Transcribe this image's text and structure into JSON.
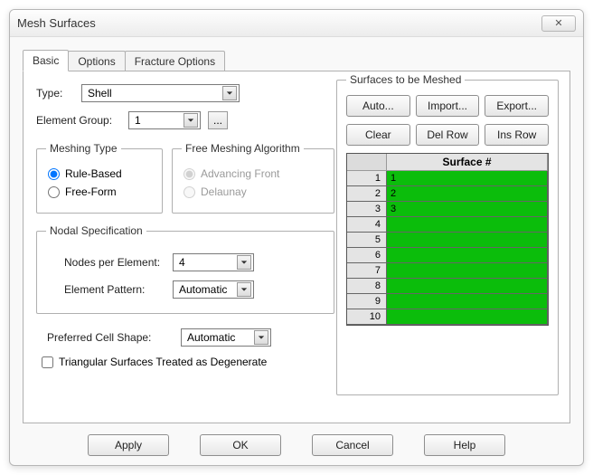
{
  "window": {
    "title": "Mesh Surfaces"
  },
  "tabs": {
    "basic": "Basic",
    "options": "Options",
    "fracture": "Fracture Options"
  },
  "labels": {
    "type": "Type:",
    "element_group": "Element Group:",
    "meshing_type": "Meshing Type",
    "rule_based": "Rule-Based",
    "free_form": "Free-Form",
    "free_meshing": "Free Meshing Algorithm",
    "advancing_front": "Advancing Front",
    "delaunay": "Delaunay",
    "nodal_spec": "Nodal Specification",
    "nodes_per_elem": "Nodes per Element:",
    "element_pattern": "Element Pattern:",
    "pref_cell_shape": "Preferred Cell Shape:",
    "triangular": "Triangular Surfaces Treated as Degenerate",
    "surfaces_group": "Surfaces to be Meshed",
    "surface_col": "Surface #",
    "ellipsis": "..."
  },
  "values": {
    "type": "Shell",
    "element_group": "1",
    "nodes_per_elem": "4",
    "element_pattern": "Automatic",
    "pref_cell_shape": "Automatic"
  },
  "right_buttons": {
    "auto": "Auto...",
    "import": "Import...",
    "export": "Export...",
    "clear": "Clear",
    "delrow": "Del Row",
    "insrow": "Ins Row"
  },
  "grid": {
    "rows": [
      {
        "idx": "1",
        "val": "1"
      },
      {
        "idx": "2",
        "val": "2"
      },
      {
        "idx": "3",
        "val": "3"
      },
      {
        "idx": "4",
        "val": ""
      },
      {
        "idx": "5",
        "val": ""
      },
      {
        "idx": "6",
        "val": ""
      },
      {
        "idx": "7",
        "val": ""
      },
      {
        "idx": "8",
        "val": ""
      },
      {
        "idx": "9",
        "val": ""
      },
      {
        "idx": "10",
        "val": ""
      }
    ]
  },
  "bottom": {
    "apply": "Apply",
    "ok": "OK",
    "cancel": "Cancel",
    "help": "Help"
  }
}
